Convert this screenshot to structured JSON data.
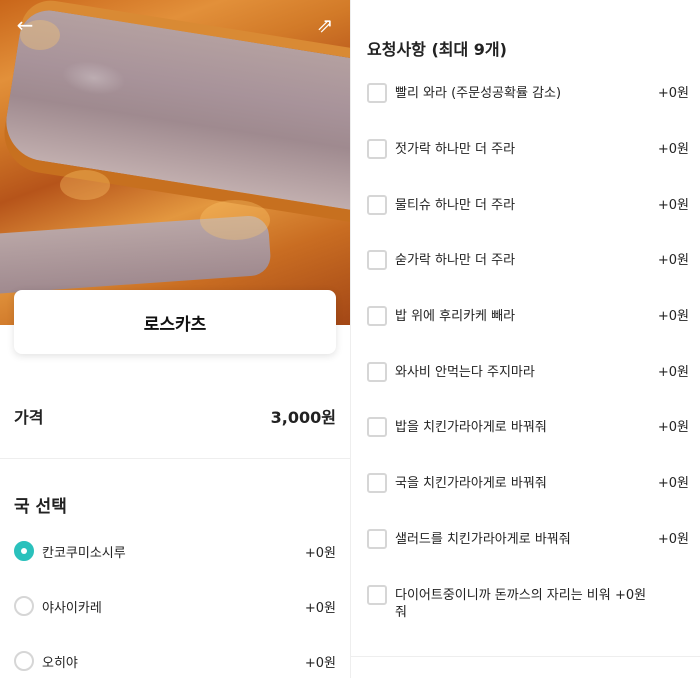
{
  "header": {
    "back_icon": "arrow-left-icon",
    "share_icon": "share-external-icon"
  },
  "product": {
    "name": "로스카츠"
  },
  "price": {
    "label": "가격",
    "value": "3,000원"
  },
  "soup": {
    "title": "국 선택",
    "options": [
      {
        "label": "칸코쿠미소시루",
        "price": "+0원",
        "selected": true
      },
      {
        "label": "야사이카레",
        "price": "+0원",
        "selected": false
      },
      {
        "label": "오히야",
        "price": "+0원",
        "selected": false
      }
    ]
  },
  "requests": {
    "title": "요청사항 (최대 9개)",
    "items": [
      {
        "label": "빨리 와라 (주문성공확률 감소)",
        "price": "+0원"
      },
      {
        "label": "젓가락 하나만 더 주라",
        "price": "+0원"
      },
      {
        "label": "물티슈 하나만 더 주라",
        "price": "+0원"
      },
      {
        "label": "숟가락 하나만 더 주라",
        "price": "+0원"
      },
      {
        "label": "밥 위에 후리카케 빼라",
        "price": "+0원"
      },
      {
        "label": "와사비 안먹는다 주지마라",
        "price": "+0원"
      },
      {
        "label": "밥을 치킨가라아게로 바꿔줘",
        "price": "+0원"
      },
      {
        "label": "국을 치킨가라아게로 바꿔줘",
        "price": "+0원"
      },
      {
        "label": "샐러드를 치킨가라아게로 바꿔줘",
        "price": "+0원"
      },
      {
        "label": "다이어트중이니까 돈까스의 자리는 비워줘",
        "price": "+0원"
      }
    ]
  },
  "colors": {
    "accent": "#2ac1bc"
  }
}
